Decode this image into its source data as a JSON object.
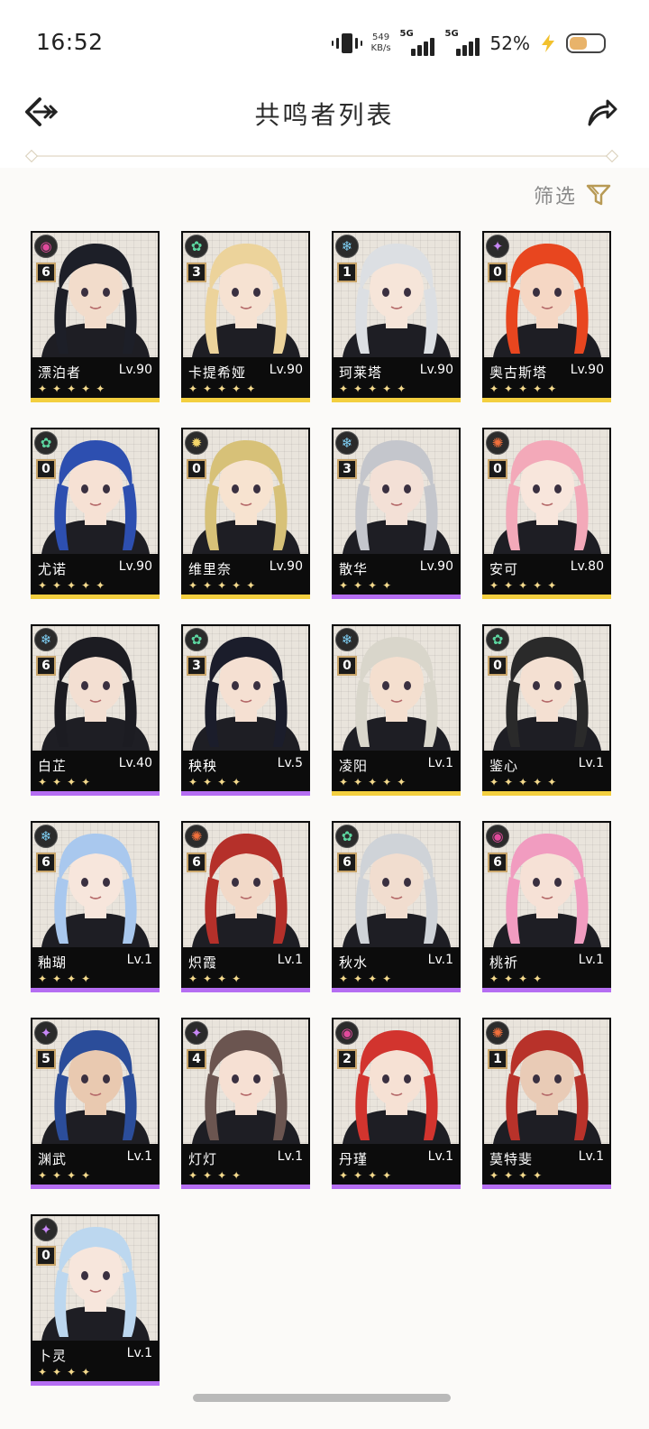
{
  "status_bar": {
    "time": "16:52",
    "net_speed_value": "549",
    "net_speed_unit": "KB/s",
    "sim1_label": "5G",
    "sim2_label": "5G",
    "battery_percent": "52%",
    "battery_level": 0.52,
    "icons": [
      "vibrate-icon",
      "signal-icon",
      "signal-icon",
      "charging-bolt-icon",
      "battery-icon"
    ]
  },
  "header": {
    "title": "共鸣者列表",
    "back_icon": "back-arrow-icon",
    "share_icon": "share-icon"
  },
  "filter": {
    "label": "筛选",
    "icon": "filter-funnel-icon"
  },
  "colors": {
    "rarity_5": "#f3cf3f",
    "rarity_4": "#b56df2",
    "glacio": "#7fd0f5",
    "aero": "#5cd6a0",
    "fusion": "#f2703c",
    "spectro": "#f3d56a",
    "electro": "#c787f5",
    "havoc": "#e14a9c"
  },
  "characters": [
    {
      "name": "漂泊者",
      "level": "Lv.90",
      "chain": "6",
      "element": "havoc",
      "rarity": 5,
      "stars": "✦✦✦✦✦",
      "hair": "#1d1f28",
      "skin": "#f2dccb"
    },
    {
      "name": "卡提希娅",
      "level": "Lv.90",
      "chain": "3",
      "element": "aero",
      "rarity": 5,
      "stars": "✦✦✦✦✦",
      "hair": "#ecd39b",
      "skin": "#f6e2d2"
    },
    {
      "name": "珂莱塔",
      "level": "Lv.90",
      "chain": "1",
      "element": "glacio",
      "rarity": 5,
      "stars": "✦✦✦✦✦",
      "hair": "#dcdfe3",
      "skin": "#f6e5d9"
    },
    {
      "name": "奥古斯塔",
      "level": "Lv.90",
      "chain": "0",
      "element": "electro",
      "rarity": 5,
      "stars": "✦✦✦✦✦",
      "hair": "#e8461f",
      "skin": "#f5d7c4"
    },
    {
      "name": "尤诺",
      "level": "Lv.90",
      "chain": "0",
      "element": "aero",
      "rarity": 5,
      "stars": "✦✦✦✦✦",
      "hair": "#2d4fb0",
      "skin": "#f6e1d4"
    },
    {
      "name": "维里奈",
      "level": "Lv.90",
      "chain": "0",
      "element": "spectro",
      "rarity": 5,
      "stars": "✦✦✦✦✦",
      "hair": "#d7c178",
      "skin": "#f7e3d0"
    },
    {
      "name": "散华",
      "level": "Lv.90",
      "chain": "3",
      "element": "glacio",
      "rarity": 4,
      "stars": "✦✦✦✦",
      "hair": "#c4c6cc",
      "skin": "#f3e0d6"
    },
    {
      "name": "安可",
      "level": "Lv.80",
      "chain": "0",
      "element": "fusion",
      "rarity": 5,
      "stars": "✦✦✦✦✦",
      "hair": "#f3a9b9",
      "skin": "#f8e6dc"
    },
    {
      "name": "白芷",
      "level": "Lv.40",
      "chain": "6",
      "element": "glacio",
      "rarity": 4,
      "stars": "✦✦✦✦",
      "hair": "#1c1c22",
      "skin": "#f3dfd2"
    },
    {
      "name": "秧秧",
      "level": "Lv.5",
      "chain": "3",
      "element": "aero",
      "rarity": 4,
      "stars": "✦✦✦✦",
      "hair": "#1b1d2b",
      "skin": "#f5e0d2"
    },
    {
      "name": "凌阳",
      "level": "Lv.1",
      "chain": "0",
      "element": "glacio",
      "rarity": 5,
      "stars": "✦✦✦✦✦",
      "hair": "#d9d6cb",
      "skin": "#f4dfcf"
    },
    {
      "name": "鉴心",
      "level": "Lv.1",
      "chain": "0",
      "element": "aero",
      "rarity": 5,
      "stars": "✦✦✦✦✦",
      "hair": "#2a2a2a",
      "skin": "#f4e0d2"
    },
    {
      "name": "釉瑚",
      "level": "Lv.1",
      "chain": "6",
      "element": "glacio",
      "rarity": 4,
      "stars": "✦✦✦✦",
      "hair": "#a9c8ee",
      "skin": "#f7e6dc"
    },
    {
      "name": "炽霞",
      "level": "Lv.1",
      "chain": "6",
      "element": "fusion",
      "rarity": 4,
      "stars": "✦✦✦✦",
      "hair": "#b5302a",
      "skin": "#f2d9c8"
    },
    {
      "name": "秋水",
      "level": "Lv.1",
      "chain": "6",
      "element": "aero",
      "rarity": 4,
      "stars": "✦✦✦✦",
      "hair": "#cfd3d8",
      "skin": "#f1ddcf"
    },
    {
      "name": "桃祈",
      "level": "Lv.1",
      "chain": "6",
      "element": "havoc",
      "rarity": 4,
      "stars": "✦✦✦✦",
      "hair": "#f19cc0",
      "skin": "#f6e1d6"
    },
    {
      "name": "渊武",
      "level": "Lv.1",
      "chain": "5",
      "element": "electro",
      "rarity": 4,
      "stars": "✦✦✦✦",
      "hair": "#2b4d9a",
      "skin": "#e9c9b0"
    },
    {
      "name": "灯灯",
      "level": "Lv.1",
      "chain": "4",
      "element": "electro",
      "rarity": 4,
      "stars": "✦✦✦✦",
      "hair": "#6b5550",
      "skin": "#f6e0d3"
    },
    {
      "name": "丹瑾",
      "level": "Lv.1",
      "chain": "2",
      "element": "havoc",
      "rarity": 4,
      "stars": "✦✦✦✦",
      "hair": "#d2342e",
      "skin": "#f6e1d4"
    },
    {
      "name": "莫特斐",
      "level": "Lv.1",
      "chain": "1",
      "element": "fusion",
      "rarity": 4,
      "stars": "✦✦✦✦",
      "hair": "#b8322a",
      "skin": "#e9cbb6"
    },
    {
      "name": "卜灵",
      "level": "Lv.1",
      "chain": "0",
      "element": "electro",
      "rarity": 4,
      "stars": "✦✦✦✦",
      "hair": "#bcd7ef",
      "skin": "#f7e6dc"
    }
  ]
}
